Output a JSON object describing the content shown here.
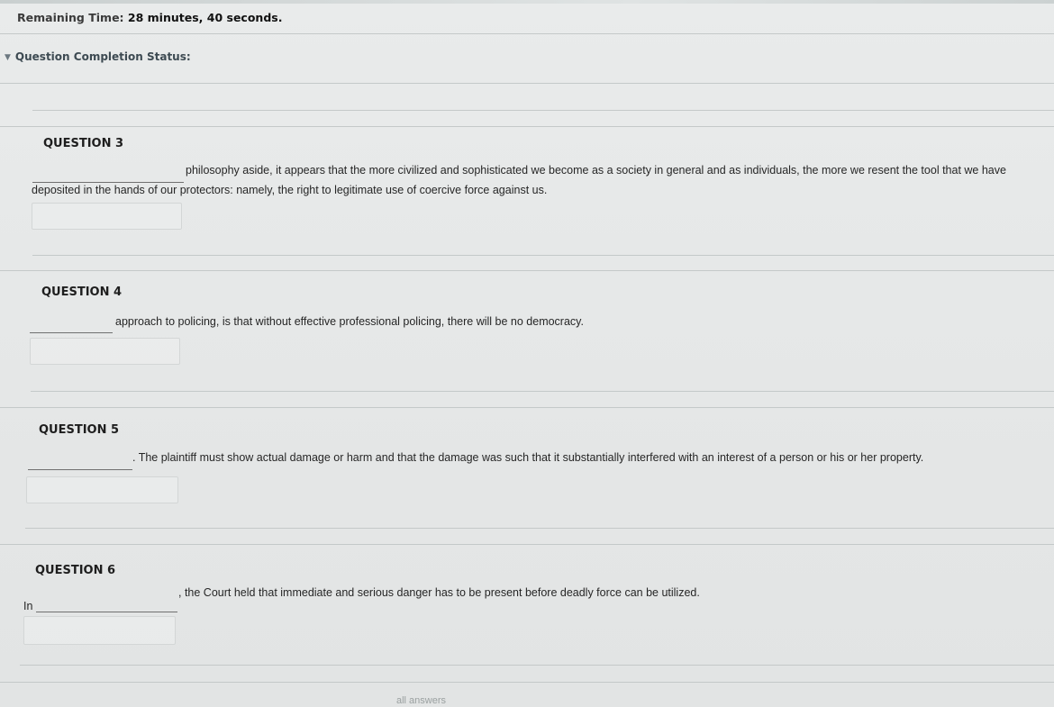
{
  "timer": {
    "label": "Remaining Time:",
    "value": "28 minutes, 40 seconds."
  },
  "completion_status": {
    "label": "Question Completion Status:",
    "icon": "chevron-down-icon"
  },
  "questions": [
    {
      "title": "QUESTION 3",
      "text_line1": "philosophy aside, it appears that the more civilized and sophisticated we become as a society in general and as individuals, the more we resent the tool that we have",
      "text_line2": "deposited in the hands of our protectors: namely, the right to legitimate use of coercive force against us.",
      "answer_value": ""
    },
    {
      "title": "QUESTION 4",
      "text_line1": "approach to policing, is that without effective professional policing, there will be no democracy.",
      "answer_value": ""
    },
    {
      "title": "QUESTION 5",
      "text_line1": ". The plaintiff must show actual damage or harm and that the damage was such that it substantially interfered with an interest of a person or his or her property.",
      "answer_value": ""
    },
    {
      "title": "QUESTION 6",
      "prefix": "In",
      "text_line1": ", the Court held that immediate and serious danger has to be present before deadly force can be utilized.",
      "answer_value": ""
    }
  ],
  "footer": {
    "partial_text": "all answers"
  }
}
